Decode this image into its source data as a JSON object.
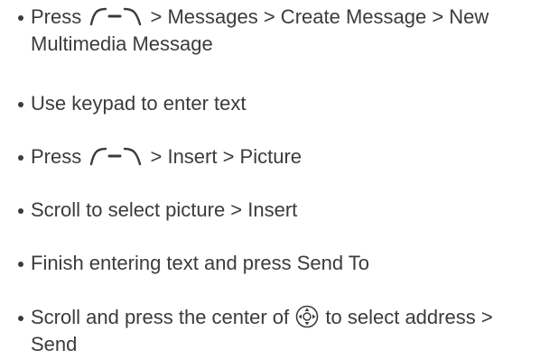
{
  "instructions": [
    {
      "pre": "Press",
      "post": "> Messages > Create Message > New Multimedia Message"
    },
    {
      "text": "Use keypad to enter text"
    },
    {
      "pre": "Press",
      "post": "> Insert > Picture"
    },
    {
      "text": "Scroll to select picture > Insert"
    },
    {
      "text": "Finish entering text and press Send To"
    },
    {
      "pre": "Scroll and press the center of",
      "post": "to select address > Send"
    }
  ],
  "icons": {
    "menu_key": "menu-key-icon",
    "navigation_key": "navigation-key-icon"
  },
  "colors": {
    "text": "#3b3b3b",
    "background": "#ffffff"
  }
}
